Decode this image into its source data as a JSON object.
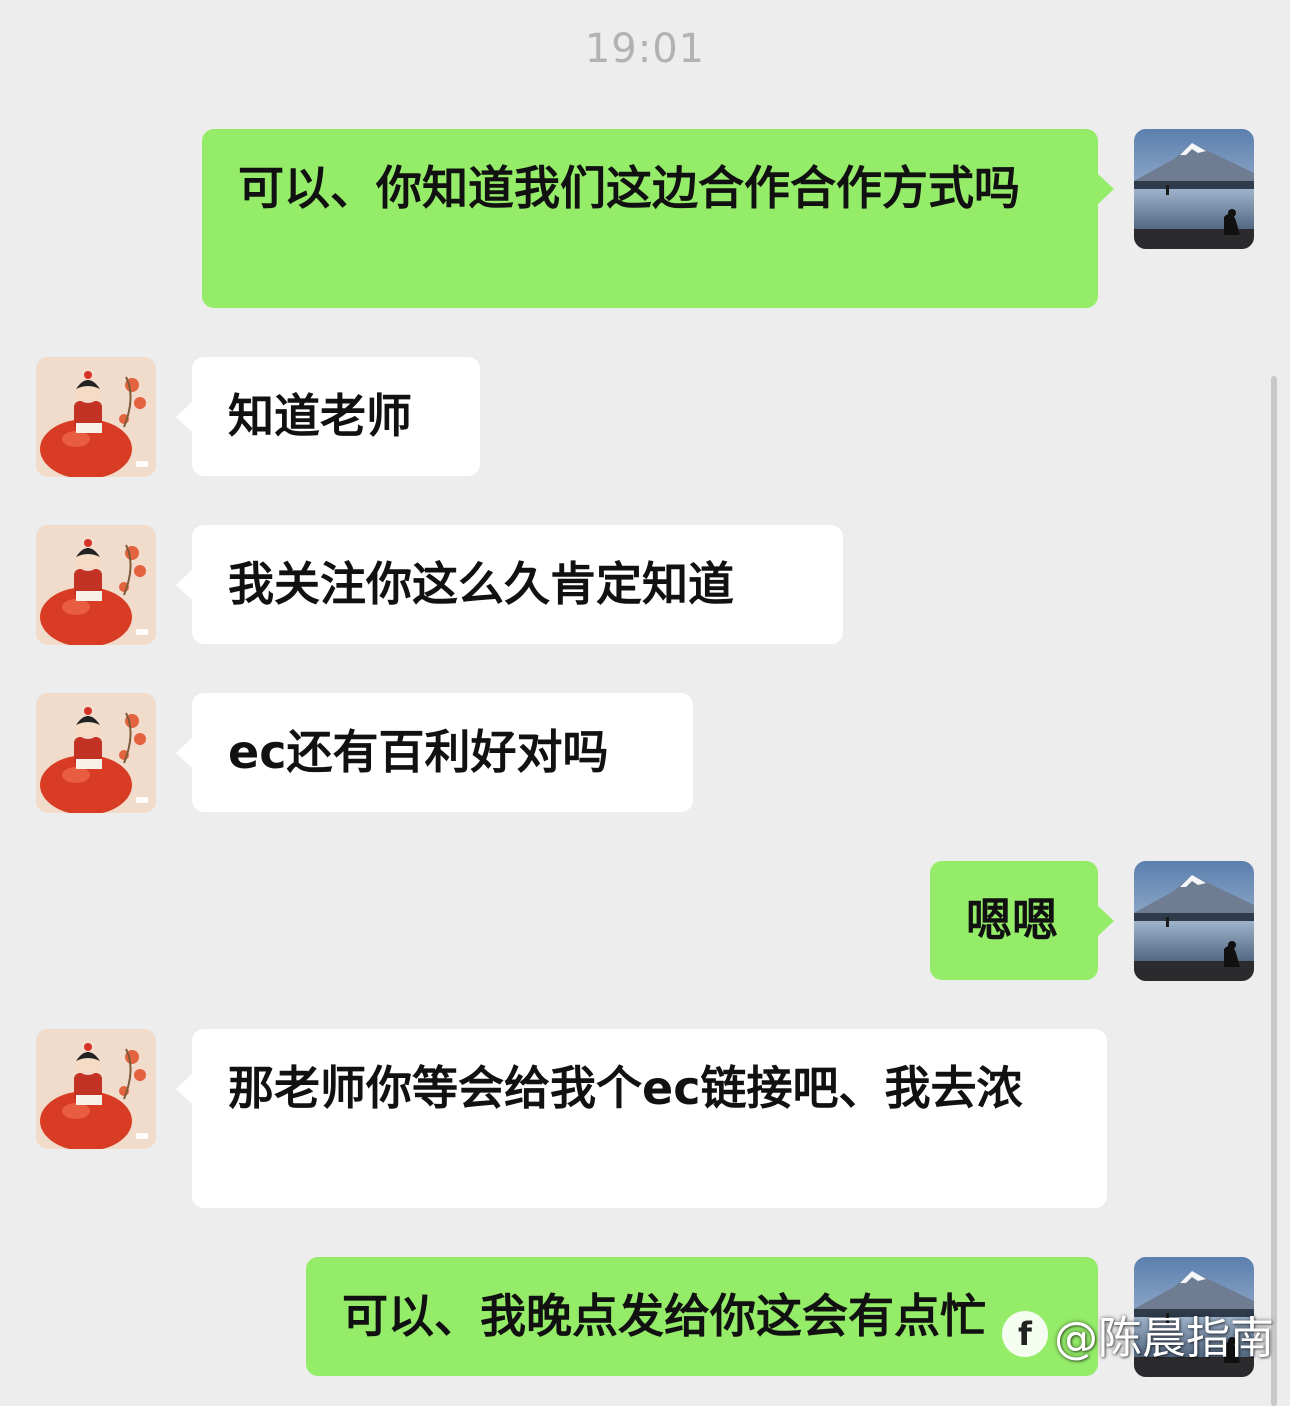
{
  "timestamp": "19:01",
  "messages": [
    {
      "side": "out",
      "text": "可以、你知道我们这边合作合作方式吗"
    },
    {
      "side": "in",
      "text": "知道老师"
    },
    {
      "side": "in",
      "text": "我关注你这么久肯定知道"
    },
    {
      "side": "in",
      "text": "ec还有百利好对吗"
    },
    {
      "side": "out",
      "text": "嗯嗯"
    },
    {
      "side": "in",
      "text": "那老师你等会给我个ec链接吧、我去浓"
    },
    {
      "side": "out",
      "text": "可以、我晚点发给你这会有点忙"
    }
  ],
  "watermark": {
    "logo": "f",
    "text": "@陈晨指南"
  },
  "colors": {
    "background": "#ededed",
    "outgoing_bubble": "#95ec69",
    "incoming_bubble": "#ffffff",
    "timestamp": "#b2b2b2"
  },
  "icons": {
    "self_avatar": "mountain-lake-avatar",
    "contact_avatar": "girl-persimmon-avatar"
  }
}
